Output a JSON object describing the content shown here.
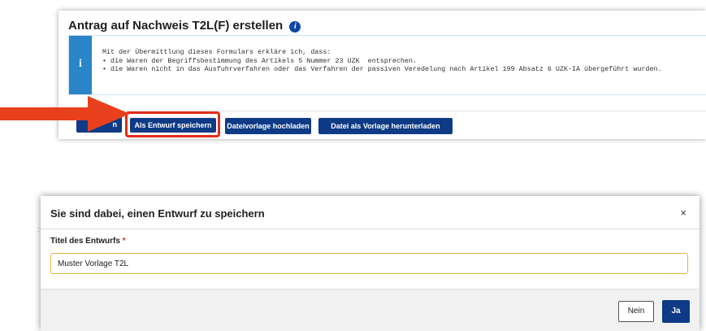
{
  "top": {
    "title": "Antrag auf Nachweis T2L(F) erstellen",
    "title_info_icon": "info-icon",
    "notice": {
      "icon": "info-icon",
      "line1": "Mit der Übermittlung dieses Formulars erkläre ich, dass:",
      "line2": "• die Waren der Begriffsbestimmung des Artikels 5 Nummer 23 UZK  entsprechen.",
      "line3": "• die Waren nicht in das Ausfuhrverfahren oder das Verfahren der passiven Veredelung nach Artikel 199 Absatz 6 UZK-IA übergeführt wurden."
    },
    "buttons": {
      "hidden_partial": "n",
      "save_draft": "Als Entwurf speichern",
      "upload_template": "Dateivorlage hochladen",
      "download_template": "Datei als Vorlage herunterladen"
    }
  },
  "annotation": {
    "arrow_color": "#e8401c",
    "highlight_color": "#e02d1b"
  },
  "modal": {
    "title": "Sie sind dabei, einen Entwurf zu speichern",
    "close": "×",
    "field_label": "Titel des Entwurfs",
    "required_mark": "*",
    "field_value": "Muster Vorlage T2L",
    "no_button": "Nein",
    "yes_button": "Ja"
  },
  "colors": {
    "primary_button": "#0e3a86",
    "notice_stripe": "#2a86c6",
    "input_focus_border": "#e6b23a"
  }
}
